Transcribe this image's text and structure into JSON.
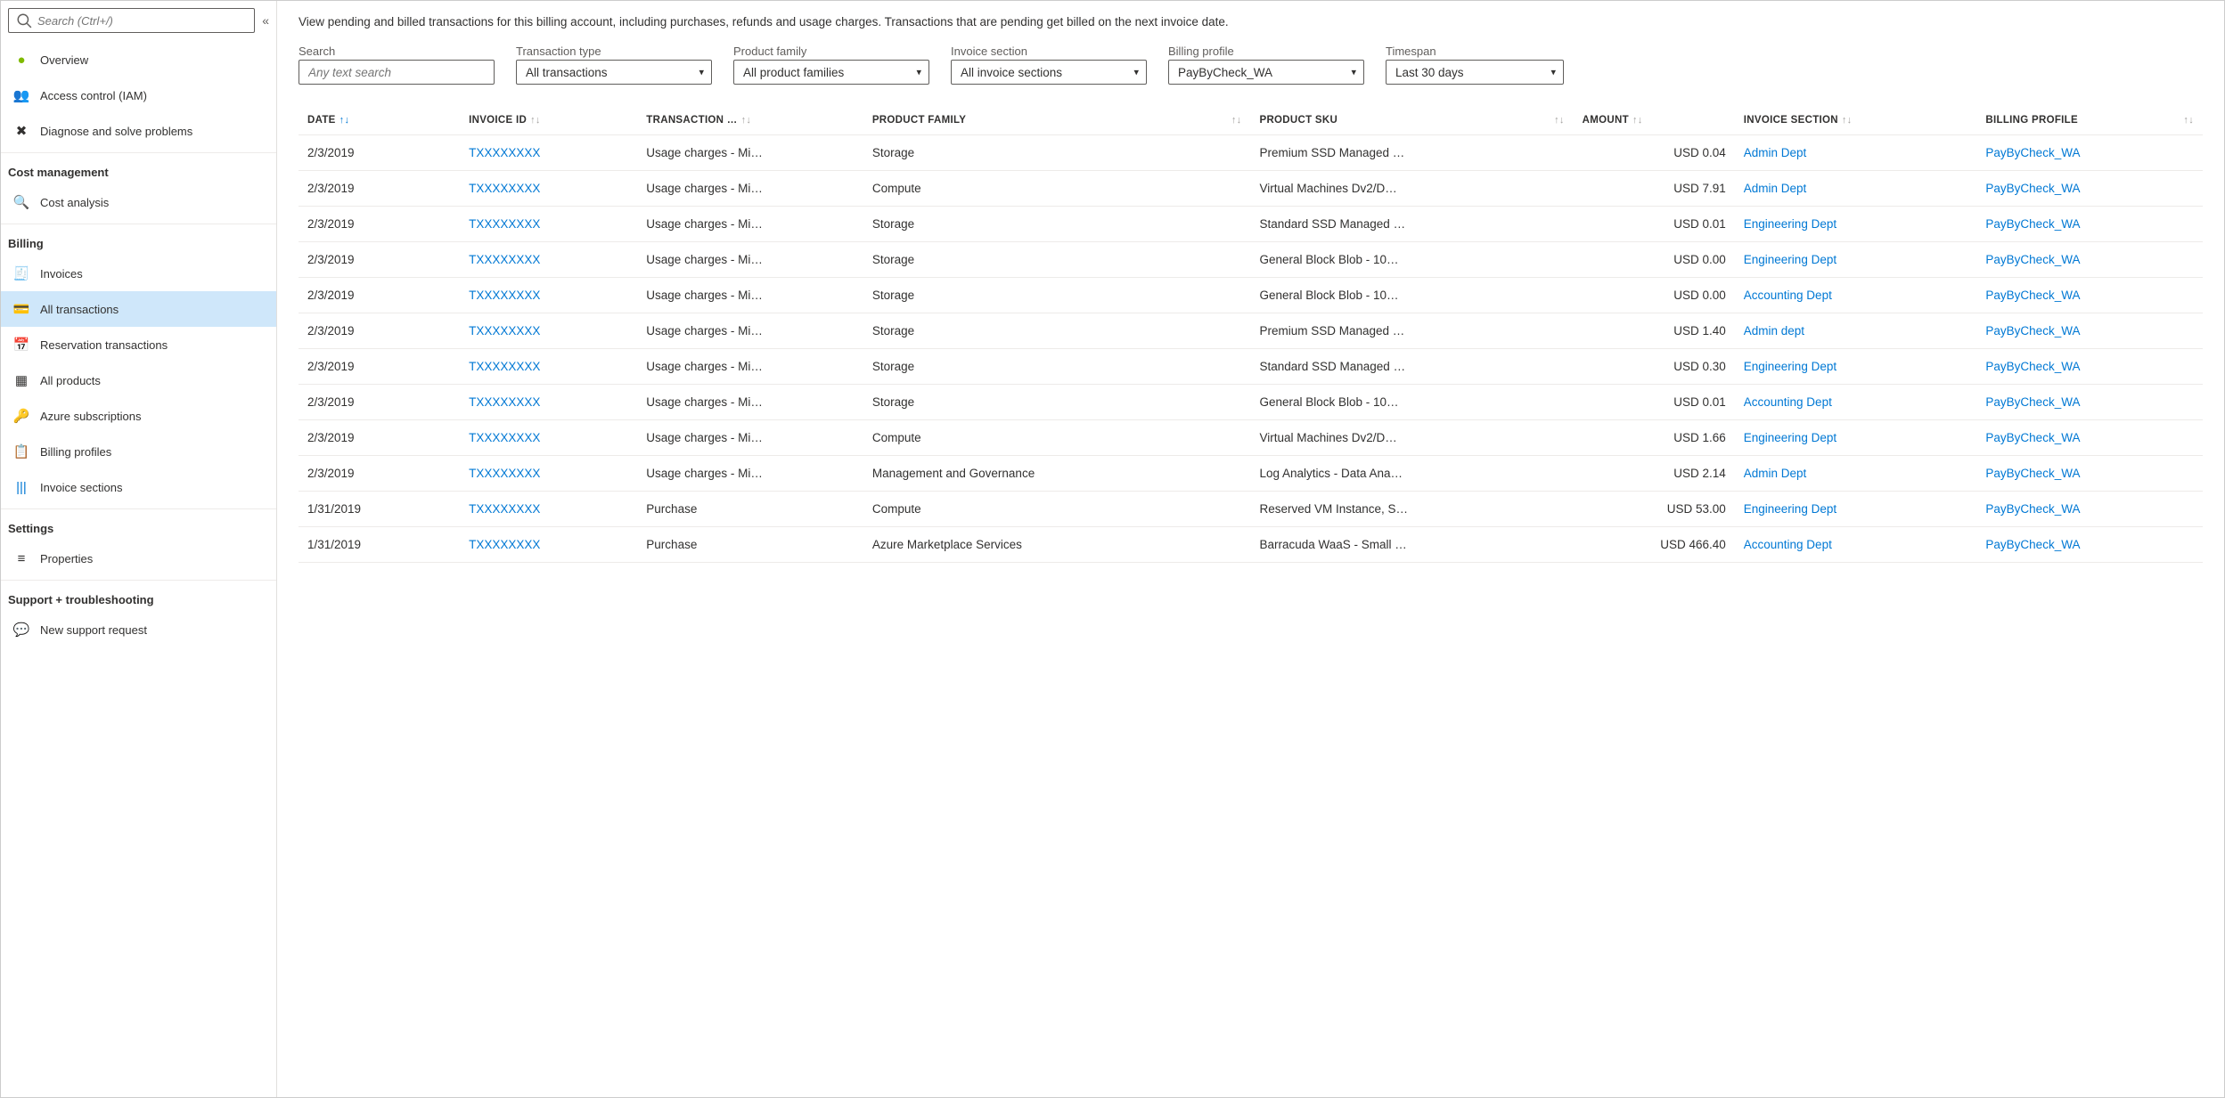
{
  "sidebar": {
    "search_placeholder": "Search (Ctrl+/)",
    "top_items": [
      {
        "icon": "overview-icon",
        "label": "Overview"
      },
      {
        "icon": "iam-icon",
        "label": "Access control (IAM)"
      },
      {
        "icon": "diagnose-icon",
        "label": "Diagnose and solve problems"
      }
    ],
    "sections": [
      {
        "heading": "Cost management",
        "items": [
          {
            "icon": "cost-analysis-icon",
            "label": "Cost analysis"
          }
        ]
      },
      {
        "heading": "Billing",
        "items": [
          {
            "icon": "invoices-icon",
            "label": "Invoices"
          },
          {
            "icon": "transactions-icon",
            "label": "All transactions",
            "active": true
          },
          {
            "icon": "reservation-icon",
            "label": "Reservation transactions"
          },
          {
            "icon": "products-icon",
            "label": "All products"
          },
          {
            "icon": "subscriptions-icon",
            "label": "Azure subscriptions"
          },
          {
            "icon": "profiles-icon",
            "label": "Billing profiles"
          },
          {
            "icon": "invoice-sections-icon",
            "label": "Invoice sections"
          }
        ]
      },
      {
        "heading": "Settings",
        "items": [
          {
            "icon": "properties-icon",
            "label": "Properties"
          }
        ]
      },
      {
        "heading": "Support + troubleshooting",
        "items": [
          {
            "icon": "support-icon",
            "label": "New support request"
          }
        ]
      }
    ]
  },
  "main": {
    "intro": "View pending and billed transactions for this billing account, including purchases, refunds and usage charges. Transactions that are pending get billed on the next invoice date.",
    "filters": {
      "search": {
        "label": "Search",
        "placeholder": "Any text search"
      },
      "transaction_type": {
        "label": "Transaction type",
        "value": "All transactions"
      },
      "product_family": {
        "label": "Product family",
        "value": "All product families"
      },
      "invoice_section": {
        "label": "Invoice section",
        "value": "All invoice sections"
      },
      "billing_profile": {
        "label": "Billing profile",
        "value": "PayByCheck_WA"
      },
      "timespan": {
        "label": "Timespan",
        "value": "Last 30 days"
      }
    },
    "columns": {
      "date": "DATE",
      "invoice_id": "INVOICE ID",
      "transaction": "TRANSACTION …",
      "product_family": "PRODUCT FAMILY",
      "product_sku": "PRODUCT SKU",
      "amount": "AMOUNT",
      "invoice_section": "INVOICE SECTION",
      "billing_profile": "BILLING PROFILE"
    },
    "rows": [
      {
        "date": "2/3/2019",
        "invoice_id": "TXXXXXXXX",
        "transaction": "Usage charges - Mi…",
        "product_family": "Storage",
        "product_sku": "Premium SSD Managed …",
        "amount": "USD 0.04",
        "invoice_section": "Admin Dept",
        "billing_profile": "PayByCheck_WA"
      },
      {
        "date": "2/3/2019",
        "invoice_id": "TXXXXXXXX",
        "transaction": "Usage charges - Mi…",
        "product_family": "Compute",
        "product_sku": "Virtual Machines Dv2/D…",
        "amount": "USD 7.91",
        "invoice_section": "Admin Dept",
        "billing_profile": "PayByCheck_WA"
      },
      {
        "date": "2/3/2019",
        "invoice_id": "TXXXXXXXX",
        "transaction": "Usage charges - Mi…",
        "product_family": "Storage",
        "product_sku": "Standard SSD Managed …",
        "amount": "USD 0.01",
        "invoice_section": "Engineering Dept",
        "billing_profile": "PayByCheck_WA"
      },
      {
        "date": "2/3/2019",
        "invoice_id": "TXXXXXXXX",
        "transaction": "Usage charges - Mi…",
        "product_family": "Storage",
        "product_sku": "General Block Blob - 10…",
        "amount": "USD 0.00",
        "invoice_section": "Engineering Dept",
        "billing_profile": "PayByCheck_WA"
      },
      {
        "date": "2/3/2019",
        "invoice_id": "TXXXXXXXX",
        "transaction": "Usage charges - Mi…",
        "product_family": "Storage",
        "product_sku": "General Block Blob - 10…",
        "amount": "USD 0.00",
        "invoice_section": "Accounting Dept",
        "billing_profile": "PayByCheck_WA"
      },
      {
        "date": "2/3/2019",
        "invoice_id": "TXXXXXXXX",
        "transaction": "Usage charges - Mi…",
        "product_family": "Storage",
        "product_sku": "Premium SSD Managed …",
        "amount": "USD 1.40",
        "invoice_section": "Admin dept",
        "billing_profile": "PayByCheck_WA"
      },
      {
        "date": "2/3/2019",
        "invoice_id": "TXXXXXXXX",
        "transaction": "Usage charges - Mi…",
        "product_family": "Storage",
        "product_sku": "Standard SSD Managed …",
        "amount": "USD 0.30",
        "invoice_section": "Engineering Dept",
        "billing_profile": "PayByCheck_WA"
      },
      {
        "date": "2/3/2019",
        "invoice_id": "TXXXXXXXX",
        "transaction": "Usage charges - Mi…",
        "product_family": "Storage",
        "product_sku": "General Block Blob - 10…",
        "amount": "USD 0.01",
        "invoice_section": "Accounting Dept",
        "billing_profile": "PayByCheck_WA"
      },
      {
        "date": "2/3/2019",
        "invoice_id": "TXXXXXXXX",
        "transaction": "Usage charges - Mi…",
        "product_family": "Compute",
        "product_sku": "Virtual Machines Dv2/D…",
        "amount": "USD 1.66",
        "invoice_section": "Engineering Dept",
        "billing_profile": "PayByCheck_WA"
      },
      {
        "date": "2/3/2019",
        "invoice_id": "TXXXXXXXX",
        "transaction": "Usage charges - Mi…",
        "product_family": "Management and Governance",
        "product_sku": "Log Analytics - Data Ana…",
        "amount": "USD 2.14",
        "invoice_section": "Admin Dept",
        "billing_profile": "PayByCheck_WA"
      },
      {
        "date": "1/31/2019",
        "invoice_id": "TXXXXXXXX",
        "transaction": "Purchase",
        "product_family": "Compute",
        "product_sku": "Reserved VM Instance, S…",
        "amount": "USD 53.00",
        "invoice_section": "Engineering Dept",
        "billing_profile": "PayByCheck_WA"
      },
      {
        "date": "1/31/2019",
        "invoice_id": "TXXXXXXXX",
        "transaction": "Purchase",
        "product_family": "Azure Marketplace Services",
        "product_sku": "Barracuda WaaS - Small …",
        "amount": "USD 466.40",
        "invoice_section": "Accounting Dept",
        "billing_profile": "PayByCheck_WA"
      }
    ]
  },
  "icons": {
    "overview-icon": "●",
    "iam-icon": "👥",
    "diagnose-icon": "✖",
    "cost-analysis-icon": "🔍",
    "invoices-icon": "🧾",
    "transactions-icon": "💳",
    "reservation-icon": "📅",
    "products-icon": "▦",
    "subscriptions-icon": "🔑",
    "profiles-icon": "📋",
    "invoice-sections-icon": "|||",
    "properties-icon": "≡",
    "support-icon": "💬"
  }
}
